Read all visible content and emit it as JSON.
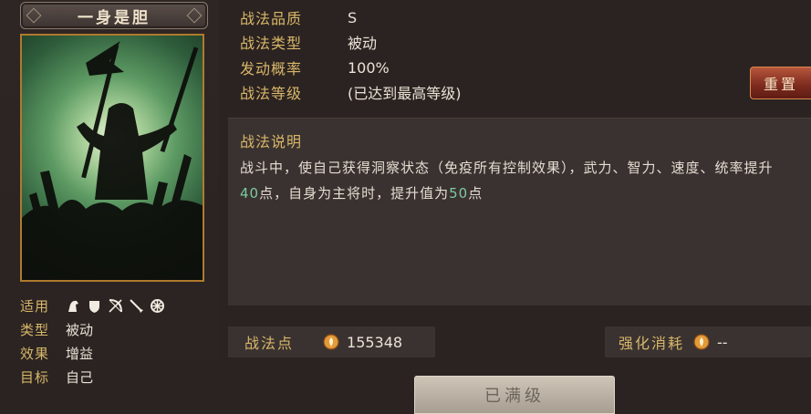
{
  "skill": {
    "name": "一身是胆"
  },
  "attributes": {
    "applicable_label": "适用",
    "troop_icons": [
      "cavalry-icon",
      "shield-icon",
      "archer-icon",
      "spear-icon",
      "siege-icon"
    ],
    "type_label": "类型",
    "type_value": "被动",
    "effect_label": "效果",
    "effect_value": "增益",
    "target_label": "目标",
    "target_value": "自己"
  },
  "info": {
    "quality_label": "战法品质",
    "quality_value": "S",
    "category_label": "战法类型",
    "category_value": "被动",
    "rate_label": "发动概率",
    "rate_value": "100%",
    "level_label": "战法等级",
    "level_value": "(已达到最高等级)"
  },
  "reset_button": "重置",
  "description": {
    "title": "战法说明",
    "part1": "战斗中，使自己获得洞察状态（免疫所有控制效果），武力、智力、速度、统率提升",
    "value1": "40",
    "part2": "点，自身为主将时，提升值为",
    "value2": "50",
    "part3": "点"
  },
  "points": {
    "label": "战法点",
    "value": "155348"
  },
  "upgrade_cost": {
    "label": "强化消耗",
    "value": "--"
  },
  "max_level_button": "已满级",
  "colors": {
    "gold_label": "#d8b76a",
    "highlight": "#7ec9a2",
    "reset_red": "#7c2a1e",
    "frame_gold": "#b07a2e"
  }
}
